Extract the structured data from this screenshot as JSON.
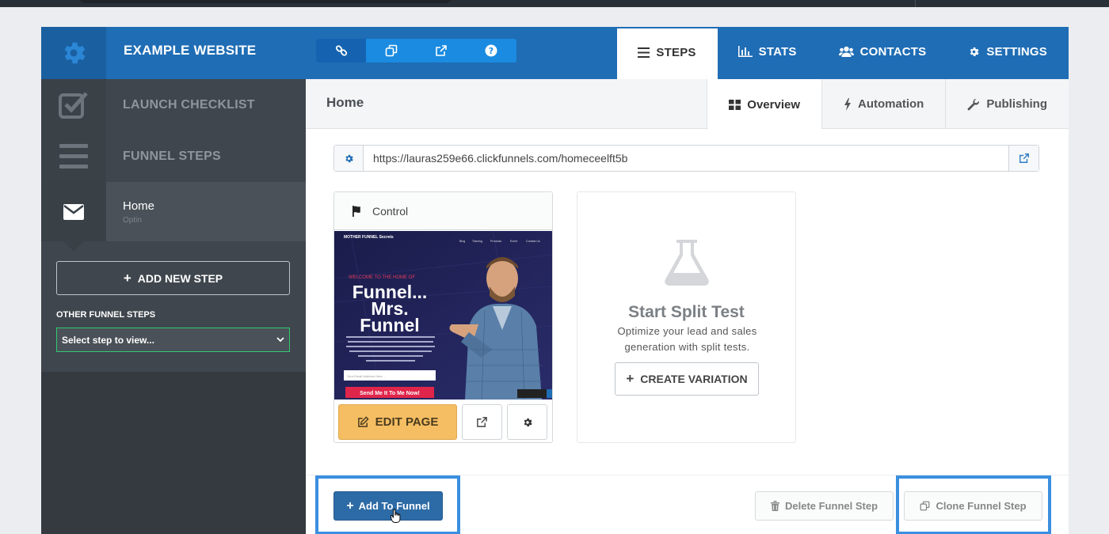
{
  "header": {
    "site_title": "EXAMPLE WEBSITE",
    "tools": [
      "link-icon",
      "clone-icon",
      "external-link-icon",
      "help-icon"
    ],
    "tabs": [
      {
        "label": "STEPS",
        "icon": "bars-icon",
        "active": true
      },
      {
        "label": "STATS",
        "icon": "bar-chart-icon"
      },
      {
        "label": "CONTACTS",
        "icon": "users-icon"
      },
      {
        "label": "SETTINGS",
        "icon": "gear-icon"
      }
    ]
  },
  "sidebar": {
    "launch_checklist": "LAUNCH CHECKLIST",
    "funnel_steps": "FUNNEL STEPS",
    "current_step": {
      "name": "Home",
      "type": "Optin"
    },
    "add_new_step": "ADD NEW STEP",
    "other_steps_label": "OTHER FUNNEL STEPS",
    "select_placeholder": "Select step to view..."
  },
  "main": {
    "page_name": "Home",
    "subtabs": [
      {
        "label": "Overview",
        "icon": "grid-icon",
        "active": true
      },
      {
        "label": "Automation",
        "icon": "bolt-icon"
      },
      {
        "label": "Publishing",
        "icon": "wrench-icon"
      }
    ],
    "url": "https://lauras259e66.clickfunnels.com/homeceelft5b",
    "control_card": {
      "label": "Control",
      "edit_label": "EDIT PAGE",
      "thumbnail": {
        "brand": "MOTHER FUNNEL Secrets",
        "nav": [
          "Blog",
          "Training",
          "Products",
          "Event",
          "Contact Us"
        ],
        "kicker": "WELCOME TO THE HOME OF",
        "headline_1": "Funnel...",
        "headline_2": "Mrs.",
        "headline_3": "Funnel",
        "email_placeholder": "Your Email Address Here...",
        "cta": "Send Me It To Me Now!"
      }
    },
    "split_test": {
      "title": "Start Split Test",
      "description": "Optimize your lead and sales generation with split tests.",
      "create_label": "CREATE VARIATION"
    },
    "footer": {
      "add_to_funnel": "Add To Funnel",
      "delete_step": "Delete Funnel Step",
      "clone_step": "Clone Funnel Step"
    }
  },
  "colors": {
    "header_blue": "#1f6db5",
    "sidebar_dark": "#3f464d",
    "edit_yellow": "#f5be63",
    "highlight_blue": "#3b8fe0"
  }
}
